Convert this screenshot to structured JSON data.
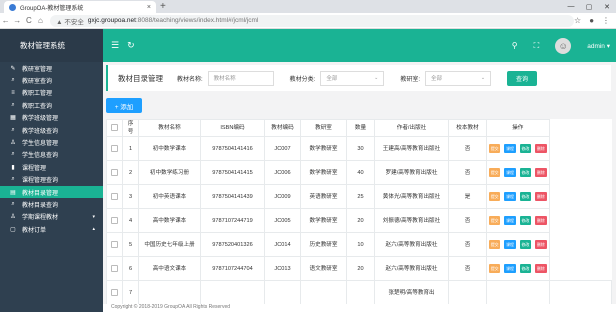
{
  "browser": {
    "tab_title": "GroupOA-教材管理系统",
    "tab_close": "×",
    "new_tab": "+",
    "url_warning": "▲ 不安全",
    "url_host": "gxjc.groupoa.net",
    "url_path": ":8088/teaching/views/index.html#/jcml/jcml"
  },
  "sidebar": {
    "brand": "教材管理系统",
    "items": [
      {
        "icon": "✎",
        "label": "教研室管理"
      },
      {
        "icon": "⌕",
        "label": "教研室查询"
      },
      {
        "icon": "≡",
        "label": "教职工管理"
      },
      {
        "icon": "⌕",
        "label": "教职工查询"
      },
      {
        "icon": "▦",
        "label": "教学班级管理"
      },
      {
        "icon": "⌕",
        "label": "教学班级查询"
      },
      {
        "icon": "♙",
        "label": "学生信息管理"
      },
      {
        "icon": "⌕",
        "label": "学生信息查询"
      },
      {
        "icon": "▮",
        "label": "课程管理"
      },
      {
        "icon": "⌕",
        "label": "课程管理查询"
      },
      {
        "icon": "▤",
        "label": "教材目录管理",
        "active": true
      },
      {
        "icon": "⌕",
        "label": "教材目录查询"
      },
      {
        "icon": "♙",
        "label": "学期课程教材",
        "caret": "▾"
      },
      {
        "icon": "▢",
        "label": "教材订单",
        "caret": "▴"
      }
    ]
  },
  "topbar": {
    "menu_icon": "☰",
    "refresh_icon": "↻",
    "tool1": "⚲",
    "tool2": "⛶",
    "user": "admin ▾"
  },
  "filter": {
    "title": "教材目录管理",
    "name_label": "教材名称:",
    "name_placeholder": "教材名称",
    "cat_label": "教材分类:",
    "cat_value": "全部",
    "room_label": "教研室:",
    "room_value": "全部",
    "query": "查询"
  },
  "add_label": "+ 添加",
  "table": {
    "headers": [
      "",
      "序号",
      "教材名称",
      "ISBN编码",
      "教材编码",
      "教研室",
      "数量",
      "作者/出版社",
      "校本教材",
      "操作"
    ],
    "rows": [
      [
        "1",
        "初中数学课本",
        "9787504141416",
        "JC007",
        "数学教研室",
        "30",
        "王建高/高等教育出版社",
        "否"
      ],
      [
        "2",
        "初中数学练习册",
        "9787504141415",
        "JC006",
        "数学教研室",
        "40",
        "罗建/高等教育出版社",
        "否"
      ],
      [
        "3",
        "初中英语课本",
        "9787504141439",
        "JC009",
        "英语教研室",
        "25",
        "黄体光/高等教育出版社",
        "是"
      ],
      [
        "4",
        "高中数学课本",
        "9787107244719",
        "JC005",
        "数学教研室",
        "20",
        "刘振德/高等教育出版社",
        "否"
      ],
      [
        "5",
        "中国历史七年级上册",
        "9787520401326",
        "JC014",
        "历史教研室",
        "10",
        "赵六/高等教育出版社",
        "否"
      ],
      [
        "6",
        "高中语文课本",
        "9787107244704",
        "JC013",
        "语文教研室",
        "20",
        "赵六/高等教育出版社",
        "否"
      ],
      [
        "7",
        "",
        "",
        "",
        "",
        "",
        "张楚明/高等教育出",
        "",
        ""
      ]
    ],
    "actions": [
      "提交",
      "课程",
      "修改",
      "删除"
    ]
  },
  "footer": "Copyright © 2018-2019 GroupOA All Rights Reserved"
}
